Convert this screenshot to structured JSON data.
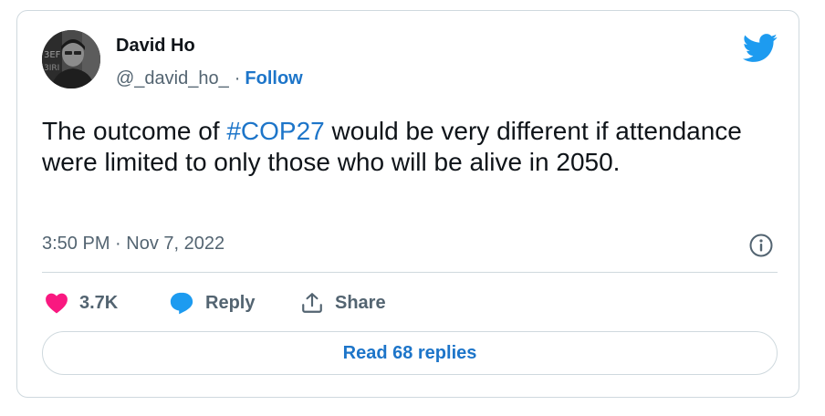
{
  "author": {
    "name": "David Ho",
    "handle": "@_david_ho_",
    "separator": "·",
    "follow_label": "Follow"
  },
  "tweet": {
    "text_before": "The outcome of ",
    "hashtag": "#COP27",
    "text_after": " would be very different if attendance were limited to only those who will be alive in 2050.",
    "timestamp": "3:50 PM · Nov 7, 2022"
  },
  "actions": {
    "like_count": "3.7K",
    "reply_label": "Reply",
    "share_label": "Share"
  },
  "read_replies_label": "Read 68 replies",
  "icons": {
    "logo": "twitter-bird-icon",
    "info": "info-icon",
    "like": "heart-icon",
    "reply": "speech-bubble-icon",
    "share": "share-arrow-icon"
  },
  "colors": {
    "link_blue": "#1d75c9",
    "twitter_blue": "#1d9bf0",
    "like_pink": "#f91880",
    "muted_text": "#536471",
    "border": "#cfd9de"
  }
}
